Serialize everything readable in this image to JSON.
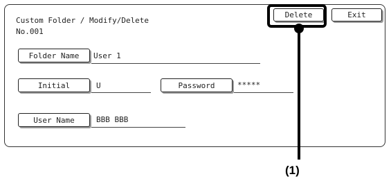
{
  "header": {
    "title": "Custom Folder / Modify/Delete",
    "folder_no": "No.001"
  },
  "buttons": {
    "delete": "Delete",
    "exit": "Exit",
    "folder_name": "Folder Name",
    "initial": "Initial",
    "password": "Password",
    "user_name": "User Name"
  },
  "fields": {
    "folder_name": "User 1",
    "initial": "U",
    "password": "*****",
    "user_name": "BBB BBB"
  },
  "annotation": {
    "label": "(1)"
  }
}
